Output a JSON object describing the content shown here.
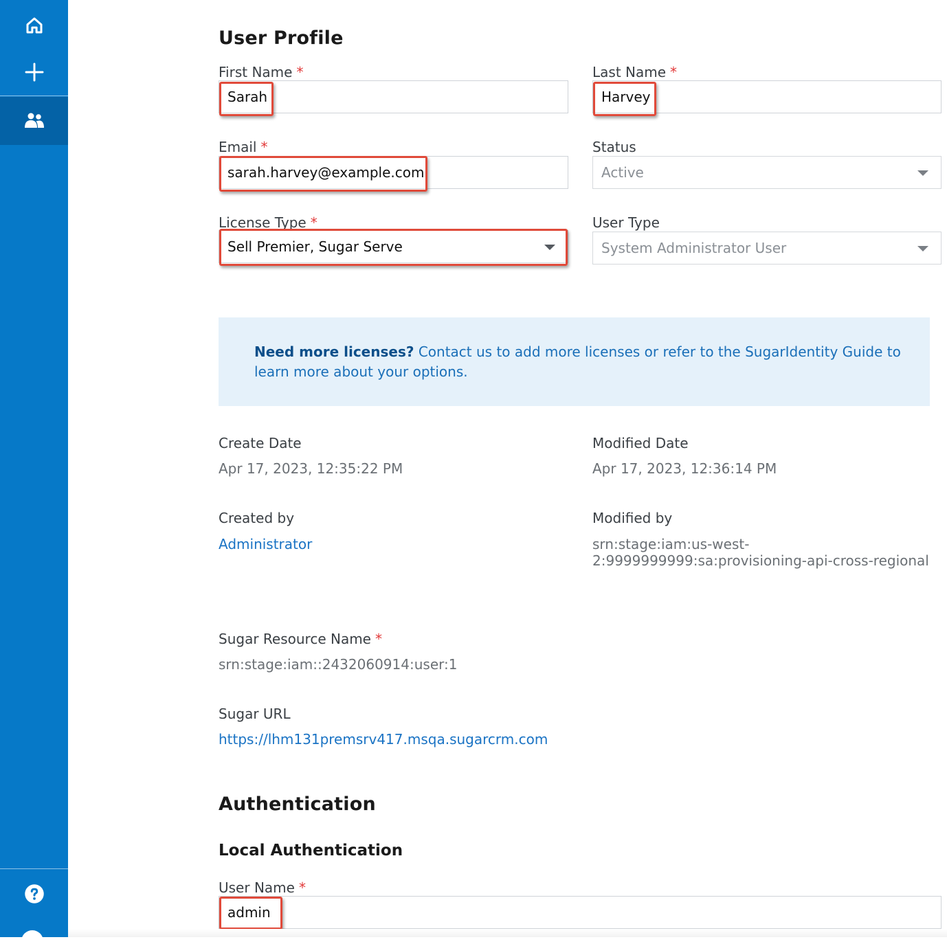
{
  "sidebar": {
    "items": [
      {
        "name": "home",
        "icon": "home-icon"
      },
      {
        "name": "add",
        "icon": "plus-icon"
      },
      {
        "name": "users",
        "icon": "users-icon",
        "active": true
      }
    ],
    "help_icon": "help-icon"
  },
  "profile": {
    "title": "User Profile",
    "first_name": {
      "label": "First Name",
      "value": "Sarah",
      "required": "*"
    },
    "last_name": {
      "label": "Last Name",
      "value": "Harvey",
      "required": "*"
    },
    "email": {
      "label": "Email",
      "value": "sarah.harvey@example.com",
      "required": "*"
    },
    "status": {
      "label": "Status",
      "value": "Active"
    },
    "license_type": {
      "label": "License Type",
      "value": "Sell Premier, Sugar Serve",
      "required": "*"
    },
    "user_type": {
      "label": "User Type",
      "value": "System Administrator User"
    }
  },
  "notice": {
    "bold": "Need more licenses?",
    "link1": "Contact us",
    "text1": " to add more licenses or refer to the ",
    "link2": "SugarIdentity Guide",
    "text2": " to learn more about your options."
  },
  "meta": {
    "create_date_label": "Create Date",
    "create_date": "Apr 17, 2023, 12:35:22 PM",
    "modified_date_label": "Modified Date",
    "modified_date": "Apr 17, 2023, 12:36:14 PM",
    "created_by_label": "Created by",
    "created_by": "Administrator",
    "modified_by_label": "Modified by",
    "modified_by_line1": "srn:stage:iam:us-west-",
    "modified_by_line2": "2:9999999999:sa:provisioning-api-cross-regional",
    "srn_label": "Sugar Resource Name",
    "srn_required": "*",
    "srn": "srn:stage:iam::2432060914:user:1",
    "url_label": "Sugar URL",
    "url": "https://lhm131premsrv417.msqa.sugarcrm.com"
  },
  "auth": {
    "title": "Authentication",
    "subtitle": "Local Authentication",
    "user_name": {
      "label": "User Name",
      "value": "admin",
      "required": "*"
    }
  },
  "colors": {
    "sidebar": "#0679c8",
    "sidebar_active": "#0462a6",
    "highlight": "#e04a3a",
    "link": "#1a73c4",
    "notice_bg": "#e5f1fa"
  }
}
